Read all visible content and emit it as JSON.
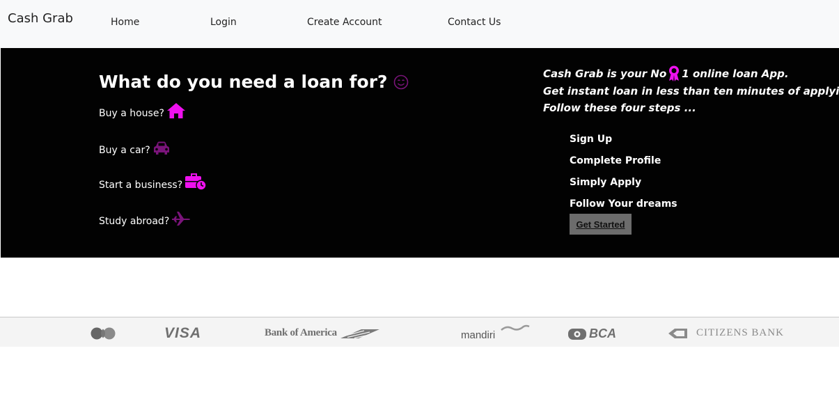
{
  "navbar": {
    "brand": "Cash Grab",
    "links": [
      {
        "label": "Home"
      },
      {
        "label": "Login"
      },
      {
        "label": "Create Account"
      },
      {
        "label": "Contact Us"
      }
    ]
  },
  "hero": {
    "title": "What do you need a loan for?",
    "loan_options": [
      {
        "label": "Buy a house?",
        "icon": "house-icon"
      },
      {
        "label": "Buy a car?",
        "icon": "car-icon"
      },
      {
        "label": "Start a business?",
        "icon": "briefcase-clock-icon"
      },
      {
        "label": "Study abroad?",
        "icon": "airplane-icon"
      }
    ],
    "promo": {
      "line1_part1": "Cash Grab is your No",
      "line1_part2": "1 online loan App.",
      "line2": "Get instant loan in less than ten minutes of applying.",
      "line3": "Follow these four steps ..."
    },
    "steps": [
      "Sign Up",
      "Complete Profile",
      "Simply Apply",
      "Follow Your dreams"
    ],
    "cta_label": "Get Started"
  },
  "partners": {
    "logos": [
      {
        "name": "mastercard-logo"
      },
      {
        "name": "visa-logo",
        "text": "VISA"
      },
      {
        "name": "bank-of-america-logo",
        "text": "Bank of America"
      },
      {
        "name": "mandiri-logo",
        "text": "mandiri"
      },
      {
        "name": "bca-logo",
        "text": "BCA"
      },
      {
        "name": "citizens-bank-logo",
        "text": "CITIZENS BANK"
      }
    ]
  },
  "colors": {
    "accent_magenta": "#ee11ee",
    "accent_purple": "#7a147a",
    "hero_bg": "#020202",
    "navbar_bg": "#f8f9fa",
    "button_bg": "#6c6c6c",
    "logo_grey": "#6f6f6f"
  }
}
